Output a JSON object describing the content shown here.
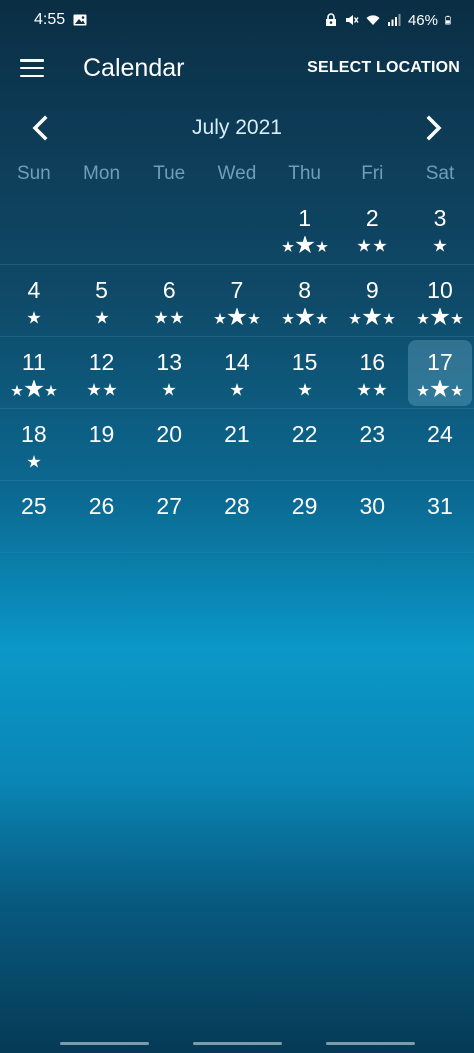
{
  "status_bar": {
    "time": "4:55",
    "battery": "46%",
    "icons": [
      "gallery-icon",
      "lock-icon",
      "mute-icon",
      "wifi-icon",
      "signal-icon",
      "battery-icon"
    ]
  },
  "app_bar": {
    "title": "Calendar",
    "action_label": "SELECT LOCATION",
    "menu_icon": "hamburger-menu-icon"
  },
  "month_nav": {
    "label": "July 2021",
    "prev_icon": "chevron-left-icon",
    "next_icon": "chevron-right-icon"
  },
  "weekdays": [
    "Sun",
    "Mon",
    "Tue",
    "Wed",
    "Thu",
    "Fri",
    "Sat"
  ],
  "weeks": [
    [
      {
        "day": ""
      },
      {
        "day": ""
      },
      {
        "day": ""
      },
      {
        "day": ""
      },
      {
        "day": "1",
        "rating": 3
      },
      {
        "day": "2",
        "rating": 2
      },
      {
        "day": "3",
        "rating": 1
      }
    ],
    [
      {
        "day": "4",
        "rating": 1
      },
      {
        "day": "5",
        "rating": 1
      },
      {
        "day": "6",
        "rating": 2
      },
      {
        "day": "7",
        "rating": 3
      },
      {
        "day": "8",
        "rating": 3
      },
      {
        "day": "9",
        "rating": 3
      },
      {
        "day": "10",
        "rating": 3
      }
    ],
    [
      {
        "day": "11",
        "rating": 3
      },
      {
        "day": "12",
        "rating": 2
      },
      {
        "day": "13",
        "rating": 1
      },
      {
        "day": "14",
        "rating": 1
      },
      {
        "day": "15",
        "rating": 1
      },
      {
        "day": "16",
        "rating": 2
      },
      {
        "day": "17",
        "rating": 3,
        "selected": true
      }
    ],
    [
      {
        "day": "18",
        "rating": 1
      },
      {
        "day": "19",
        "rating": 0
      },
      {
        "day": "20",
        "rating": 0
      },
      {
        "day": "21",
        "rating": 0
      },
      {
        "day": "22",
        "rating": 0
      },
      {
        "day": "23",
        "rating": 0
      },
      {
        "day": "24",
        "rating": 0
      }
    ],
    [
      {
        "day": "25",
        "rating": 0
      },
      {
        "day": "26",
        "rating": 0
      },
      {
        "day": "27",
        "rating": 0
      },
      {
        "day": "28",
        "rating": 0
      },
      {
        "day": "29",
        "rating": 0
      },
      {
        "day": "30",
        "rating": 0
      },
      {
        "day": "31",
        "rating": 0
      }
    ]
  ],
  "colors": {
    "text": "#ffffff",
    "weekday": "#6f9fb8",
    "selected_bg": "#8cc8e1"
  }
}
